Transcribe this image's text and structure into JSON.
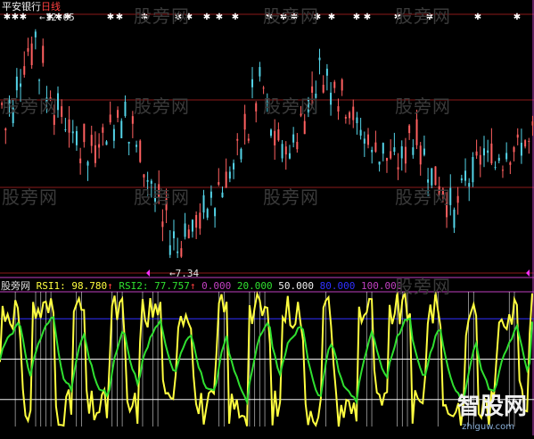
{
  "top_panel": {
    "stock_name": "平安银行",
    "period": "日线",
    "high_label": "12.65",
    "low_label": "7.34",
    "high_arrow": "←",
    "low_arrow": "←"
  },
  "bottom_panel": {
    "brand": "股旁网",
    "rsi1_name": "RSI1:",
    "rsi1_value": "98.780",
    "rsi2_name": "RSI2:",
    "rsi2_value": "77.757",
    "up_arrow": "↑",
    "levels": [
      "0.000",
      "20.000",
      "50.000",
      "80.000",
      "100.000"
    ]
  },
  "watermark": "股旁网",
  "logo": {
    "main": "智股网",
    "sub": "zhiguw.com"
  },
  "colors": {
    "background": "#000000",
    "candle_up": "#ff6060",
    "candle_down": "#54d4e8",
    "grid_red": "#8c1a1a",
    "panel_border": "#c040c0",
    "rsi1": "#ffff40",
    "rsi2": "#30e030",
    "level_blue": "#3030ff",
    "level_white": "#f0f0f0",
    "marker_white": "#ffffff",
    "marker_magenta": "#ff30ff"
  },
  "chart_data": [
    {
      "type": "candlestick",
      "title": "平安银行 日线",
      "ylim": [
        7.0,
        13.0
      ],
      "high": 12.65,
      "low": 7.34,
      "closes": [
        10.8,
        10.2,
        11.0,
        10.5,
        11.8,
        11.2,
        12.3,
        11.6,
        12.65,
        11.4,
        11.9,
        10.8,
        11.2,
        10.4,
        11.0,
        10.2,
        10.6,
        9.8,
        10.3,
        9.6,
        10.1,
        9.4,
        10.0,
        9.6,
        10.4,
        9.8,
        10.6,
        10.0,
        10.9,
        10.2,
        10.8,
        9.9,
        10.5,
        9.5,
        9.9,
        8.9,
        9.4,
        8.5,
        8.9,
        8.0,
        8.4,
        7.6,
        7.9,
        7.34,
        7.8,
        8.2,
        7.7,
        8.3,
        8.0,
        8.6,
        8.2,
        8.9,
        8.5,
        9.2,
        8.7,
        9.5,
        9.0,
        9.9,
        9.4,
        10.5,
        10.1,
        11.2,
        10.7,
        11.6,
        10.9,
        10.5,
        9.8,
        10.2,
        9.6,
        10.0,
        9.5,
        10.2,
        9.9,
        10.7,
        10.3,
        11.3,
        10.9,
        11.8,
        11.3,
        11.6,
        11.0,
        11.5,
        10.8,
        11.2,
        10.5,
        10.9,
        10.2,
        10.4,
        9.9,
        10.2,
        9.6,
        10.0,
        9.5,
        9.9,
        9.4,
        9.8,
        9.3,
        9.7,
        9.5,
        10.3,
        9.9,
        10.2,
        9.5,
        9.8,
        9.1,
        9.4,
        8.8,
        9.1,
        8.5,
        8.7,
        8.3,
        8.6,
        8.9,
        9.3,
        9.0,
        9.6,
        9.3,
        9.9,
        9.5,
        9.8,
        9.4,
        9.7,
        9.5,
        9.9,
        9.6,
        10.0,
        9.7,
        10.1,
        9.8,
        10.2
      ]
    },
    {
      "type": "line",
      "series": [
        {
          "name": "RSI1",
          "last": 98.78
        },
        {
          "name": "RSI2",
          "last": 77.757
        }
      ],
      "levels": [
        0,
        20,
        50,
        80,
        100
      ],
      "ylim": [
        0,
        100
      ]
    }
  ]
}
